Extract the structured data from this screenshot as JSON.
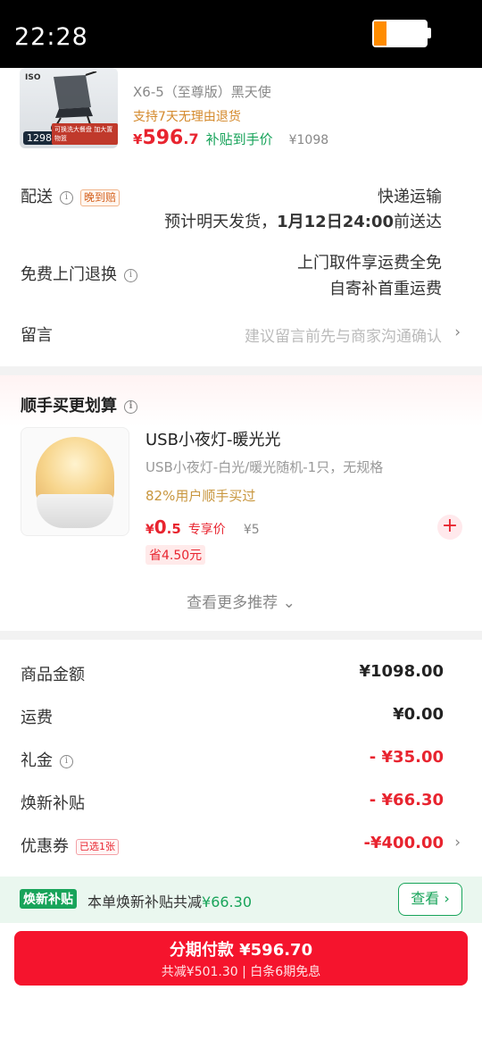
{
  "status_bar": {
    "time": "22:28",
    "battery_color": "#ff8c00"
  },
  "product": {
    "image_text": {
      "iso": "ISO",
      "price": "1298",
      "promo": "可换洗大餐盘 加大置物篮"
    },
    "variant": "X6-5（至尊版）黑天使",
    "return_note": "支持7天无理由退货",
    "price_symbol": "¥",
    "price_int": "596",
    "price_dec": ".7",
    "subsidy_label": "补贴到手价",
    "original_price": "¥1098"
  },
  "delivery": {
    "label": "配送",
    "tag": "晚到赔",
    "method": "快递运输",
    "estimate_prefix": "预计明天发货，",
    "estimate_date": "1月12日24:00",
    "estimate_suffix": "前送达"
  },
  "return_service": {
    "label": "免费上门退换",
    "line1": "上门取件享运费全免",
    "line2": "自寄补首重运费"
  },
  "message": {
    "label": "留言",
    "placeholder": "建议留言前先与商家沟通确认"
  },
  "recommend": {
    "title": "顺手买更划算",
    "item": {
      "name": "USB小夜灯-暖光光",
      "desc": "USB小夜灯-白光/暖光随机-1只，无规格",
      "buyers": "82%用户顺手买过",
      "price_symbol": "¥",
      "price_int": "0",
      "price_dec": ".5",
      "price_label": "专享价",
      "original_price": "¥5",
      "save": "省4.50元"
    },
    "more": "查看更多推荐"
  },
  "summary": {
    "rows": [
      {
        "label": "商品金额",
        "value": "¥1098.00",
        "red": false
      },
      {
        "label": "运费",
        "value": "¥0.00",
        "red": false
      },
      {
        "label": "礼金",
        "value": "- ¥35.00",
        "red": true
      },
      {
        "label": "焕新补贴",
        "value": "- ¥66.30",
        "red": true
      },
      {
        "label": "优惠券",
        "value": "-¥400.00",
        "red": true,
        "tag": "已选1张"
      }
    ]
  },
  "subsidy_bar": {
    "badge": "焕新补贴",
    "text": "本单焕新补贴共减",
    "amount": "¥66.30",
    "button": "查看"
  },
  "pay": {
    "main": "分期付款 ¥596.70",
    "sub": "共减¥501.30 | 白条6期免息"
  },
  "colors": {
    "accent_red": "#f5142d",
    "green": "#18a45a",
    "orange": "#d4892b"
  }
}
